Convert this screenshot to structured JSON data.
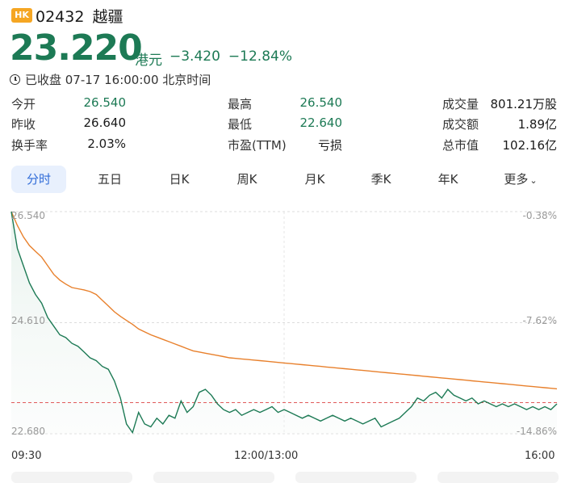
{
  "header": {
    "market_badge": "HK",
    "code": "02432",
    "name": "越疆"
  },
  "quote": {
    "price": "23.220",
    "unit": "港元",
    "change": "−3.420",
    "change_pct": "−12.84%",
    "status": "已收盘 07-17 16:00:00 北京时间"
  },
  "stats": {
    "open": {
      "label": "今开",
      "value": "26.540"
    },
    "prev_close": {
      "label": "昨收",
      "value": "26.640"
    },
    "turnover_rate": {
      "label": "换手率",
      "value": "2.03%"
    },
    "high": {
      "label": "最高",
      "value": "26.540"
    },
    "low": {
      "label": "最低",
      "value": "22.640"
    },
    "pe": {
      "label": "市盈(TTM)",
      "value": "亏损"
    },
    "volume": {
      "label": "成交量",
      "value": "801.21万股"
    },
    "amount": {
      "label": "成交额",
      "value": "1.89亿"
    },
    "market_cap": {
      "label": "总市值",
      "value": "102.16亿"
    }
  },
  "tabs": [
    "分时",
    "五日",
    "日K",
    "周K",
    "月K",
    "季K",
    "年K",
    "更多"
  ],
  "active_tab": "分时",
  "colors": {
    "down": "#1d7a55",
    "avg_line": "#e8802c",
    "prev_close_line": "#e05a5a",
    "tab_active_bg": "#e8f0fd",
    "tab_active_text": "#2f6bd8",
    "badge": "#f5a623"
  },
  "chart_data": {
    "type": "line",
    "ylabels_left": [
      "26.540",
      "24.610",
      "22.680"
    ],
    "ylabels_right": [
      "-0.38%",
      "-7.62%",
      "-14.86%"
    ],
    "xlabels": [
      "09:30",
      "12:00/13:00",
      "16:00"
    ],
    "ylim": [
      22.68,
      26.54
    ],
    "prev_close": 23.22,
    "series": [
      {
        "values": [
          26.54,
          25.9,
          25.6,
          25.3,
          25.1,
          24.95,
          24.7,
          24.55,
          24.4,
          24.35,
          24.25,
          24.2,
          24.1,
          24.0,
          23.95,
          23.85,
          23.8,
          23.6,
          23.3,
          22.85,
          22.7,
          23.05,
          22.85,
          22.8,
          22.95,
          22.85,
          23.0,
          22.95,
          23.25,
          23.05,
          23.15,
          23.4,
          23.45,
          23.35,
          23.2,
          23.1,
          23.05,
          23.1,
          23.0,
          23.05,
          23.1,
          23.05,
          23.1,
          23.15,
          23.05,
          23.1,
          23.05,
          23.0,
          22.95,
          23.0,
          22.95,
          22.9,
          22.95,
          23.0,
          22.95,
          22.9,
          22.95,
          22.9,
          22.85,
          22.9,
          22.95,
          22.8,
          22.85,
          22.9,
          22.95,
          23.05,
          23.15,
          23.3,
          23.25,
          23.35,
          23.4,
          23.3,
          23.45,
          23.35,
          23.3,
          23.25,
          23.3,
          23.2,
          23.25,
          23.2,
          23.15,
          23.2,
          23.15,
          23.2,
          23.15,
          23.1,
          23.15,
          23.1,
          23.15,
          23.1,
          23.2
        ]
      },
      {
        "values": [
          26.54,
          26.3,
          26.1,
          25.95,
          25.85,
          25.75,
          25.6,
          25.45,
          25.35,
          25.28,
          25.22,
          25.2,
          25.18,
          25.15,
          25.1,
          25.0,
          24.9,
          24.8,
          24.72,
          24.65,
          24.58,
          24.5,
          24.45,
          24.4,
          24.36,
          24.32,
          24.28,
          24.24,
          24.2,
          24.16,
          24.12,
          24.1,
          24.08,
          24.06,
          24.04,
          24.02,
          24.0,
          23.99,
          23.98,
          23.97,
          23.96,
          23.95,
          23.94,
          23.93,
          23.92,
          23.91,
          23.9,
          23.89,
          23.88,
          23.87,
          23.86,
          23.85,
          23.84,
          23.83,
          23.82,
          23.81,
          23.8,
          23.79,
          23.78,
          23.77,
          23.76,
          23.75,
          23.74,
          23.73,
          23.72,
          23.71,
          23.7,
          23.69,
          23.68,
          23.67,
          23.66,
          23.65,
          23.64,
          23.63,
          23.62,
          23.61,
          23.6,
          23.59,
          23.58,
          23.57,
          23.56,
          23.55,
          23.54,
          23.53,
          23.52,
          23.51,
          23.5,
          23.49,
          23.48,
          23.47,
          23.46
        ]
      }
    ]
  }
}
